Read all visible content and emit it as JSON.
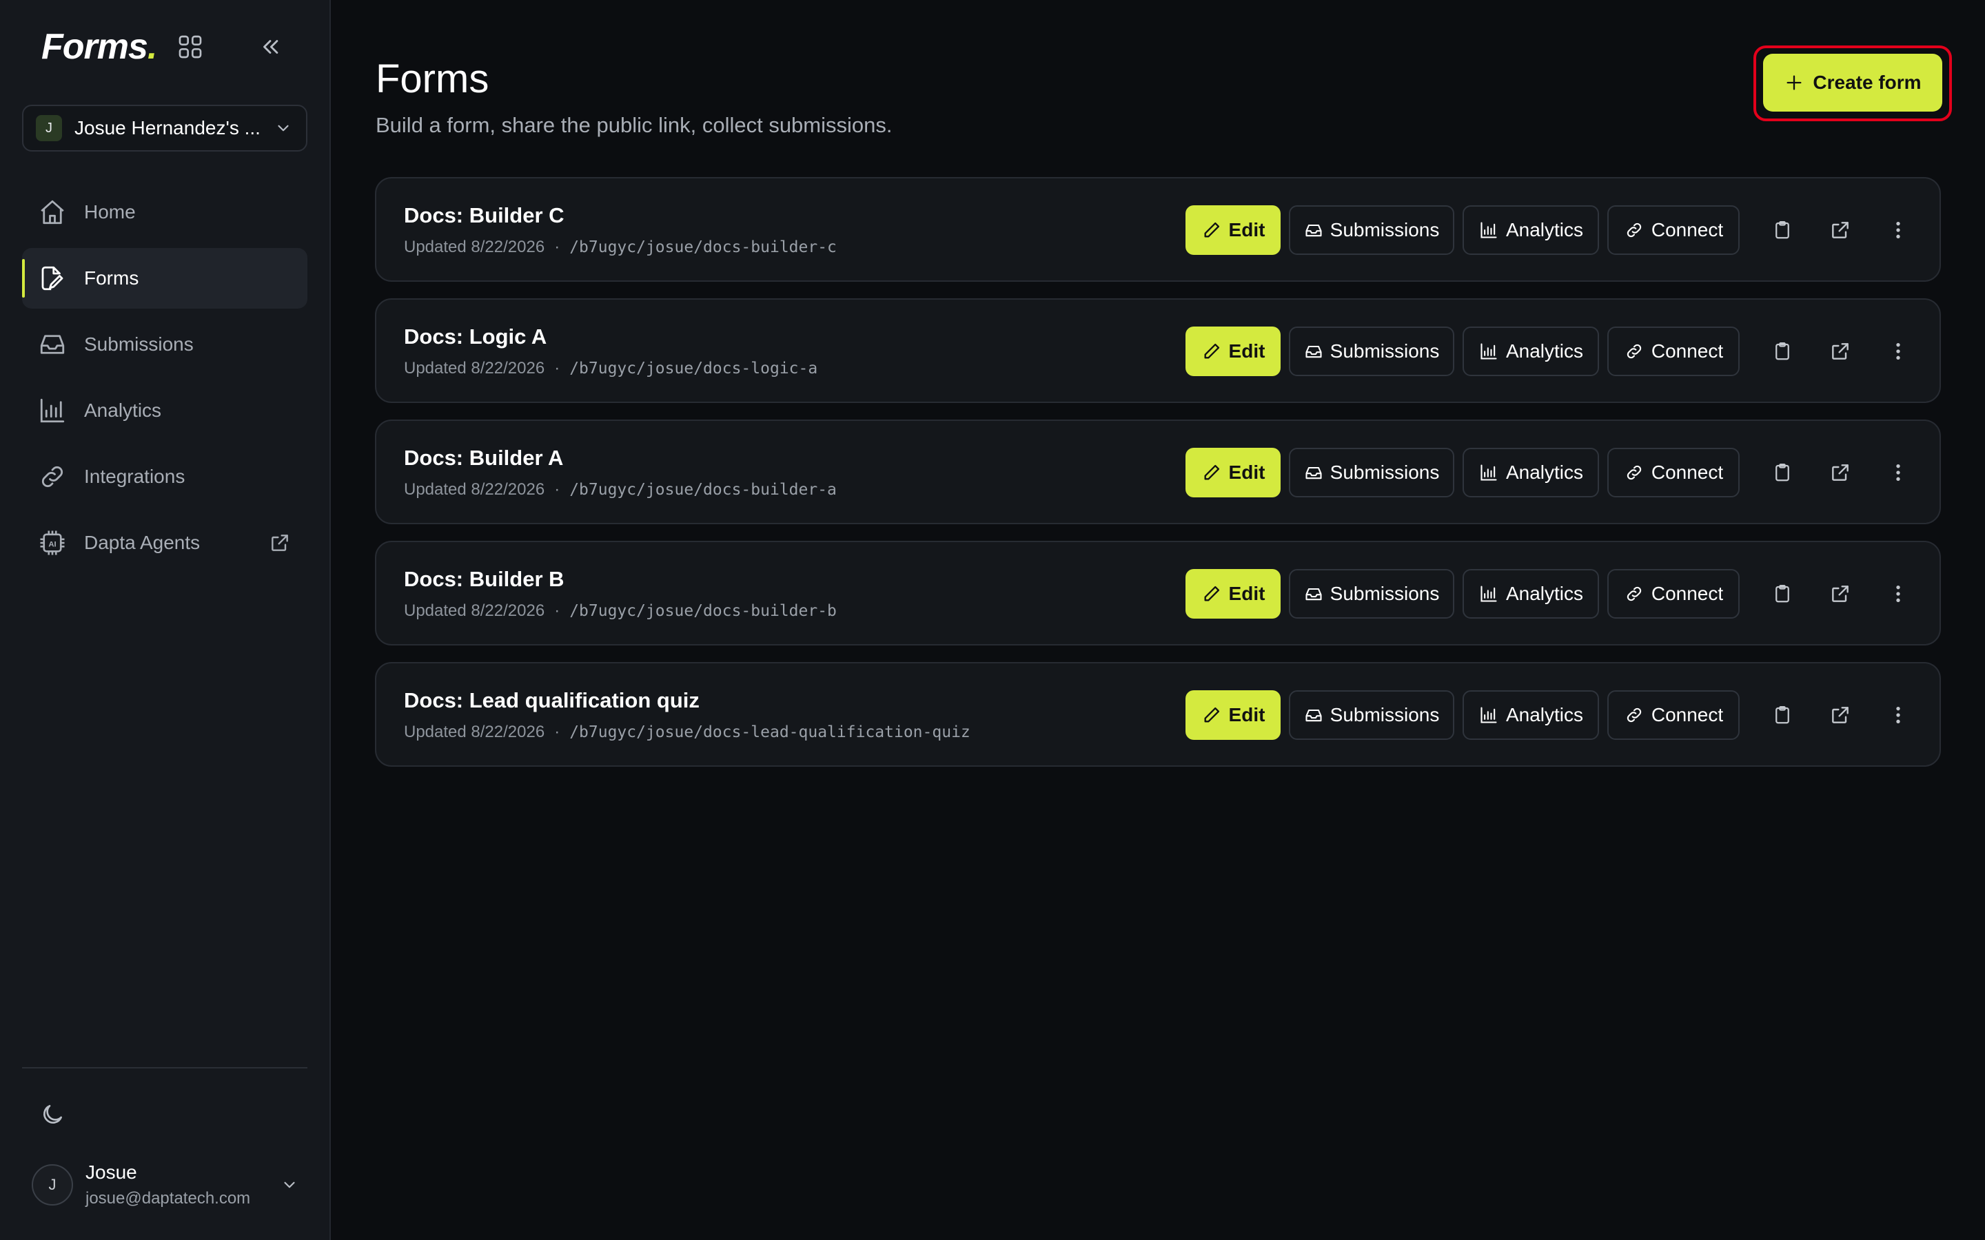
{
  "app": {
    "logo_text": "Forms",
    "logo_dot": "."
  },
  "workspace": {
    "avatar_letter": "J",
    "name": "Josue Hernandez's ..."
  },
  "nav": {
    "items": [
      {
        "label": "Home",
        "icon": "home-icon"
      },
      {
        "label": "Forms",
        "icon": "edit-document-icon",
        "active": true
      },
      {
        "label": "Submissions",
        "icon": "inbox-icon"
      },
      {
        "label": "Analytics",
        "icon": "bar-chart-icon"
      },
      {
        "label": "Integrations",
        "icon": "link-icon"
      },
      {
        "label": "Dapta Agents",
        "icon": "ai-chip-icon",
        "external": true
      }
    ]
  },
  "user": {
    "avatar_letter": "J",
    "name": "Josue",
    "email": "josue@daptatech.com"
  },
  "page": {
    "title": "Forms",
    "subtitle": "Build a form, share the public link, collect submissions.",
    "create_label": "Create form"
  },
  "buttons": {
    "edit": "Edit",
    "submissions": "Submissions",
    "analytics": "Analytics",
    "connect": "Connect"
  },
  "forms": [
    {
      "title": "Docs: Builder C",
      "updated": "Updated 8/22/2026",
      "sep": "·",
      "path": "/b7ugyc/josue/docs-builder-c"
    },
    {
      "title": "Docs: Logic A",
      "updated": "Updated 8/22/2026",
      "sep": "·",
      "path": "/b7ugyc/josue/docs-logic-a"
    },
    {
      "title": "Docs: Builder A",
      "updated": "Updated 8/22/2026",
      "sep": "·",
      "path": "/b7ugyc/josue/docs-builder-a"
    },
    {
      "title": "Docs: Builder B",
      "updated": "Updated 8/22/2026",
      "sep": "·",
      "path": "/b7ugyc/josue/docs-builder-b"
    },
    {
      "title": "Docs: Lead qualification quiz",
      "updated": "Updated 8/22/2026",
      "sep": "·",
      "path": "/b7ugyc/josue/docs-lead-qualification-quiz"
    }
  ],
  "colors": {
    "accent": "#d4ea3f",
    "background": "#0b0d10",
    "sidebar": "#15181d",
    "highlight": "#e3001b"
  }
}
